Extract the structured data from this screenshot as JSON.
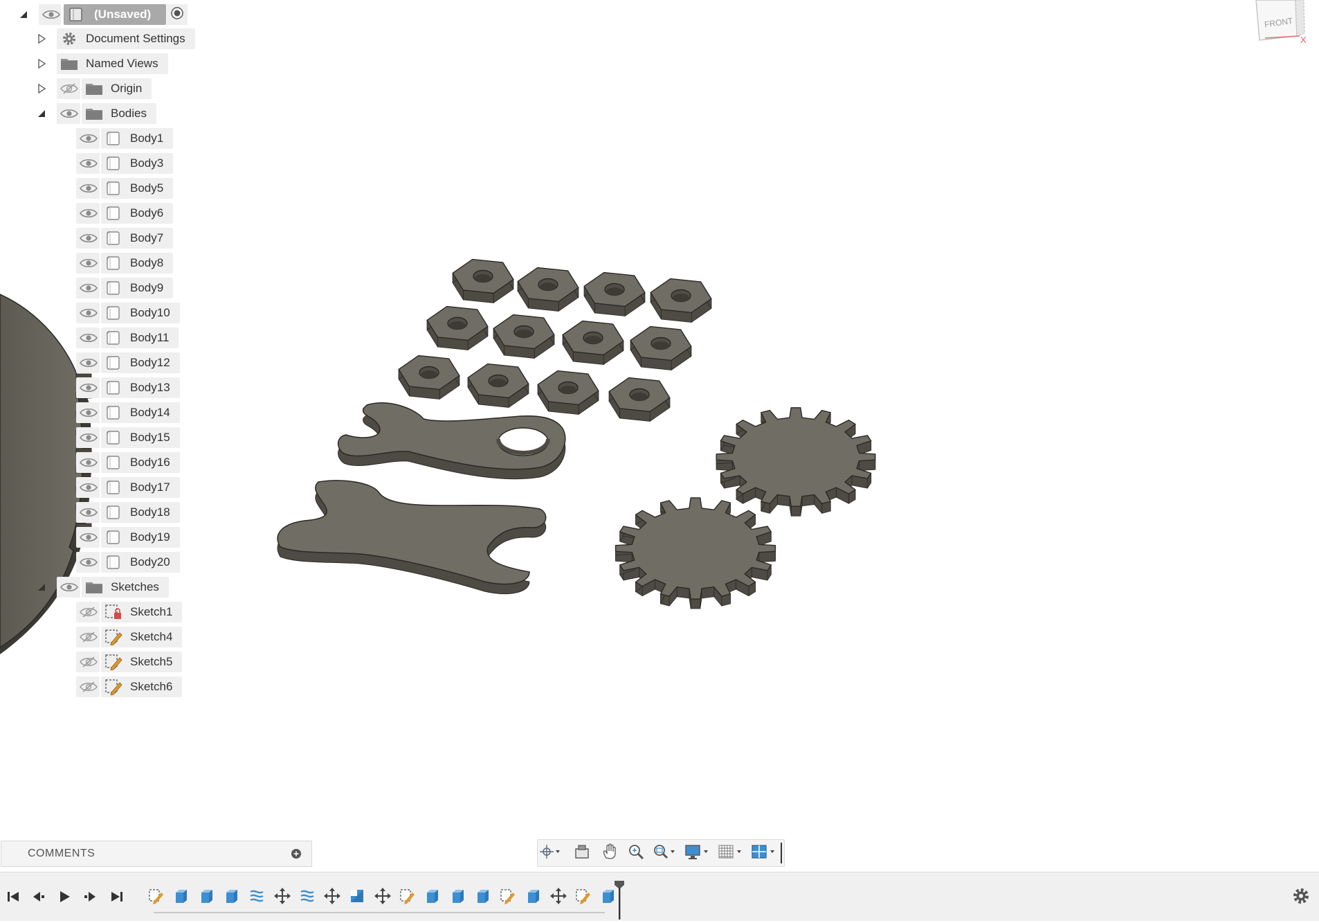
{
  "browser": {
    "root": {
      "label": "(Unsaved)",
      "expanded": true,
      "visible": true
    },
    "folders": [
      {
        "key": "document-settings",
        "label": "Document Settings",
        "icon": "gear-icon",
        "expanded": false,
        "has_eye": false
      },
      {
        "key": "named-views",
        "label": "Named Views",
        "icon": "folder-icon",
        "expanded": false,
        "has_eye": false
      },
      {
        "key": "origin",
        "label": "Origin",
        "icon": "folder-icon",
        "expanded": false,
        "has_eye": true,
        "visible": false
      },
      {
        "key": "bodies",
        "label": "Bodies",
        "icon": "folder-icon",
        "expanded": true,
        "has_eye": true,
        "visible": true
      }
    ],
    "bodies": [
      "Body1",
      "Body3",
      "Body5",
      "Body6",
      "Body7",
      "Body8",
      "Body9",
      "Body10",
      "Body11",
      "Body12",
      "Body13",
      "Body14",
      "Body15",
      "Body16",
      "Body17",
      "Body18",
      "Body19",
      "Body20"
    ],
    "sketches_folder": {
      "label": "Sketches",
      "icon": "folder-icon",
      "visible": true
    },
    "sketches": [
      {
        "label": "Sketch1",
        "visible": false,
        "icon": "sketch-locked-icon"
      },
      {
        "label": "Sketch4",
        "visible": false,
        "icon": "sketch-icon"
      },
      {
        "label": "Sketch5",
        "visible": false,
        "icon": "sketch-icon"
      },
      {
        "label": "Sketch6",
        "visible": false,
        "icon": "sketch-icon"
      }
    ]
  },
  "viewcube": {
    "face_label": "FRONT",
    "axis_label": "X"
  },
  "comments": {
    "label": "COMMENTS",
    "add_icon": "plus-circle-icon"
  },
  "nav_toolbar": {
    "buttons": [
      "orbit-icon",
      "look-at-icon",
      "pan-icon",
      "zoom-icon",
      "zoom-window-icon",
      "display-settings-icon",
      "grid-settings-icon",
      "viewports-icon"
    ]
  },
  "timeline": {
    "playback": [
      "skip-to-start-icon",
      "step-back-icon",
      "play-icon",
      "step-forward-icon",
      "skip-to-end-icon"
    ],
    "features": [
      "sketch",
      "extrude",
      "extrude",
      "extrude",
      "pattern",
      "move",
      "pattern",
      "move",
      "body",
      "move",
      "sketch",
      "extrude",
      "extrude",
      "extrude",
      "sketch",
      "extrude",
      "move",
      "sketch",
      "extrude"
    ],
    "settings_icon": "gear-icon"
  },
  "colors": {
    "model_face": "#706d64",
    "model_side": "#4e4b44",
    "model_edge": "#2b2925",
    "accent_blue": "#3d8fd1",
    "sketch_orange": "#e09a2a"
  }
}
